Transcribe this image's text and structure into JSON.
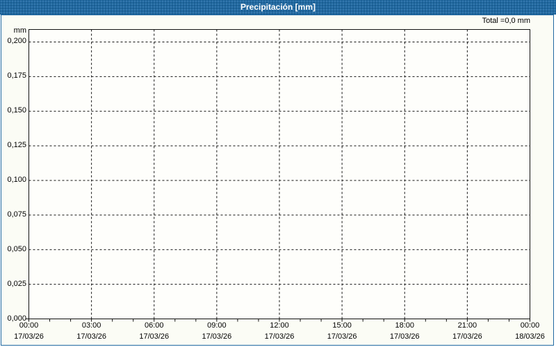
{
  "window": {
    "title": "Precipitación [mm]"
  },
  "colors": {
    "titlebar_bg": "#2069a2",
    "titlebar_text": "#ffffff",
    "window_border": "#2069a2",
    "plot_bg": "#fefefb",
    "grid_line": "#111111",
    "label_text": "#000000"
  },
  "chart_data": {
    "type": "line",
    "title": "Precipitación [mm]",
    "total_label": "Total =0,0 mm",
    "y_unit": "mm",
    "grid": "dashed",
    "legend": "none",
    "ylim": [
      0,
      0.209
    ],
    "xlim_hours": [
      0,
      24
    ],
    "minor_tick_every_hours": 1,
    "y_ticks": [
      {
        "label": "0,200",
        "value": 0.2
      },
      {
        "label": "0,175",
        "value": 0.175
      },
      {
        "label": "0,150",
        "value": 0.15
      },
      {
        "label": "0,125",
        "value": 0.125
      },
      {
        "label": "0,100",
        "value": 0.1
      },
      {
        "label": "0,075",
        "value": 0.075
      },
      {
        "label": "0,050",
        "value": 0.05
      },
      {
        "label": "0,025",
        "value": 0.025
      },
      {
        "label": "0,000",
        "value": 0.0
      }
    ],
    "x_ticks": [
      {
        "time": "00:00",
        "date": "17/03/26",
        "hour": 0
      },
      {
        "time": "03:00",
        "date": "17/03/26",
        "hour": 3
      },
      {
        "time": "06:00",
        "date": "17/03/26",
        "hour": 6
      },
      {
        "time": "09:00",
        "date": "17/03/26",
        "hour": 9
      },
      {
        "time": "12:00",
        "date": "17/03/26",
        "hour": 12
      },
      {
        "time": "15:00",
        "date": "17/03/26",
        "hour": 15
      },
      {
        "time": "18:00",
        "date": "17/03/26",
        "hour": 18
      },
      {
        "time": "21:00",
        "date": "17/03/26",
        "hour": 21
      },
      {
        "time": "00:00",
        "date": "18/03/26",
        "hour": 24
      }
    ],
    "series": [
      {
        "name": "Precipitación",
        "values": []
      }
    ]
  }
}
